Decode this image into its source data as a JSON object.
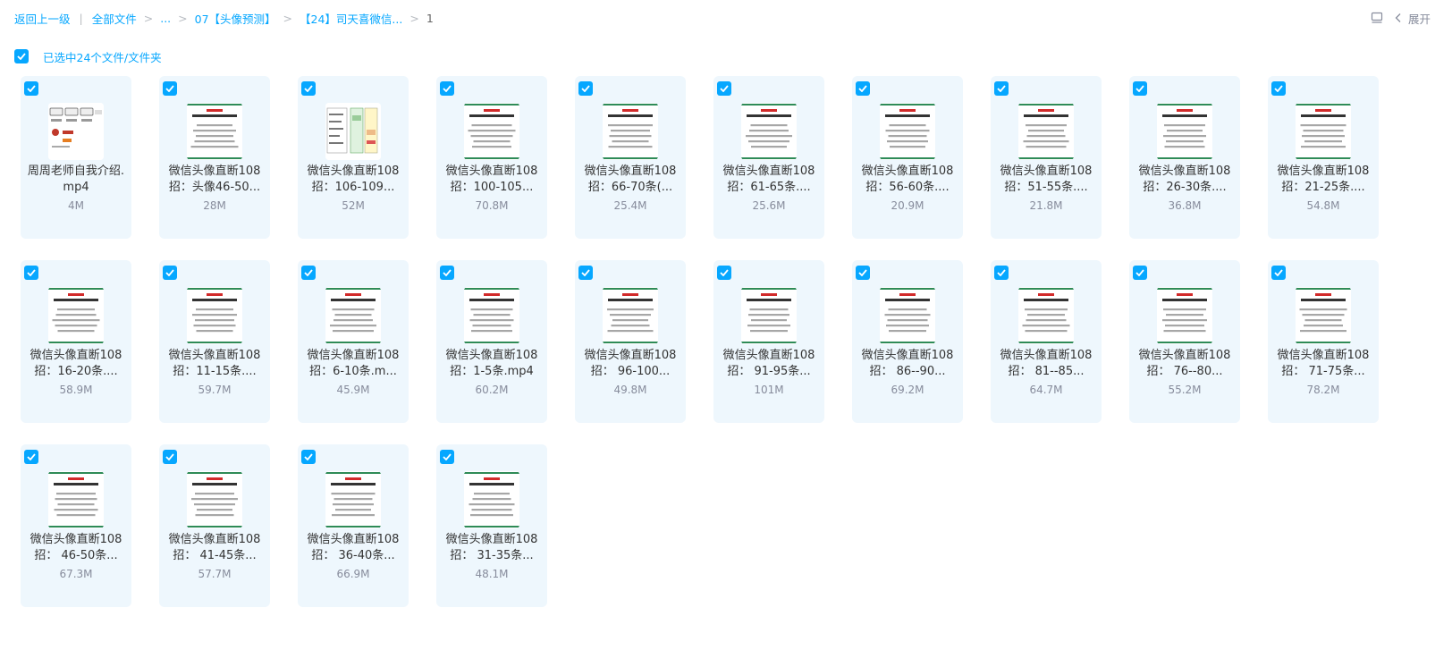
{
  "breadcrumb": {
    "back": "返回上一级",
    "root": "全部文件",
    "ellipsis": "...",
    "folder1": "07【头像预测】",
    "folder2": "【24】司天喜微信...",
    "current": "1"
  },
  "toolbar": {
    "view_icon": "list-view-icon",
    "collapse_icon": "chevron-left-icon",
    "expand_label": "展开"
  },
  "selection": {
    "text": "已选中24个文件/文件夹"
  },
  "colors": {
    "accent": "#06a7ff",
    "card_bg": "#eef7fd",
    "muted": "#878c9c"
  },
  "files": [
    {
      "name_line1": "周周老师自我介绍.",
      "name_line2": "mp4",
      "size": "4M",
      "thumb": "intro"
    },
    {
      "name_line1": "微信头像直断108",
      "name_line2": "招：头像46-50...",
      "size": "28M",
      "thumb": "doc"
    },
    {
      "name_line1": "微信头像直断108",
      "name_line2": "招：106-109...",
      "size": "52M",
      "thumb": "table"
    },
    {
      "name_line1": "微信头像直断108",
      "name_line2": "招：100-105...",
      "size": "70.8M",
      "thumb": "doc"
    },
    {
      "name_line1": "微信头像直断108",
      "name_line2": "招：66-70条(...",
      "size": "25.4M",
      "thumb": "doc"
    },
    {
      "name_line1": "微信头像直断108",
      "name_line2": "招：61-65条....",
      "size": "25.6M",
      "thumb": "doc"
    },
    {
      "name_line1": "微信头像直断108",
      "name_line2": "招：56-60条....",
      "size": "20.9M",
      "thumb": "doc"
    },
    {
      "name_line1": "微信头像直断108",
      "name_line2": "招：51-55条....",
      "size": "21.8M",
      "thumb": "doc"
    },
    {
      "name_line1": "微信头像直断108",
      "name_line2": "招：26-30条....",
      "size": "36.8M",
      "thumb": "doc"
    },
    {
      "name_line1": "微信头像直断108",
      "name_line2": "招：21-25条....",
      "size": "54.8M",
      "thumb": "doc"
    },
    {
      "name_line1": "微信头像直断108",
      "name_line2": "招：16-20条....",
      "size": "58.9M",
      "thumb": "doc"
    },
    {
      "name_line1": "微信头像直断108",
      "name_line2": "招：11-15条....",
      "size": "59.7M",
      "thumb": "doc"
    },
    {
      "name_line1": "微信头像直断108",
      "name_line2": "招：6-10条.m...",
      "size": "45.9M",
      "thumb": "doc"
    },
    {
      "name_line1": "微信头像直断108",
      "name_line2": "招：1-5条.mp4",
      "size": "60.2M",
      "thumb": "doc"
    },
    {
      "name_line1": "微信头像直断108",
      "name_line2": "招： 96-100...",
      "size": "49.8M",
      "thumb": "doc"
    },
    {
      "name_line1": "微信头像直断108",
      "name_line2": "招： 91-95条...",
      "size": "101M",
      "thumb": "doc"
    },
    {
      "name_line1": "微信头像直断108",
      "name_line2": "招： 86--90...",
      "size": "69.2M",
      "thumb": "doc"
    },
    {
      "name_line1": "微信头像直断108",
      "name_line2": "招： 81--85...",
      "size": "64.7M",
      "thumb": "doc"
    },
    {
      "name_line1": "微信头像直断108",
      "name_line2": "招： 76--80...",
      "size": "55.2M",
      "thumb": "doc"
    },
    {
      "name_line1": "微信头像直断108",
      "name_line2": "招： 71-75条...",
      "size": "78.2M",
      "thumb": "doc"
    },
    {
      "name_line1": "微信头像直断108",
      "name_line2": "招： 46-50条...",
      "size": "67.3M",
      "thumb": "doc"
    },
    {
      "name_line1": "微信头像直断108",
      "name_line2": "招： 41-45条...",
      "size": "57.7M",
      "thumb": "doc"
    },
    {
      "name_line1": "微信头像直断108",
      "name_line2": "招： 36-40条...",
      "size": "66.9M",
      "thumb": "doc"
    },
    {
      "name_line1": "微信头像直断108",
      "name_line2": "招： 31-35条...",
      "size": "48.1M",
      "thumb": "doc"
    }
  ]
}
